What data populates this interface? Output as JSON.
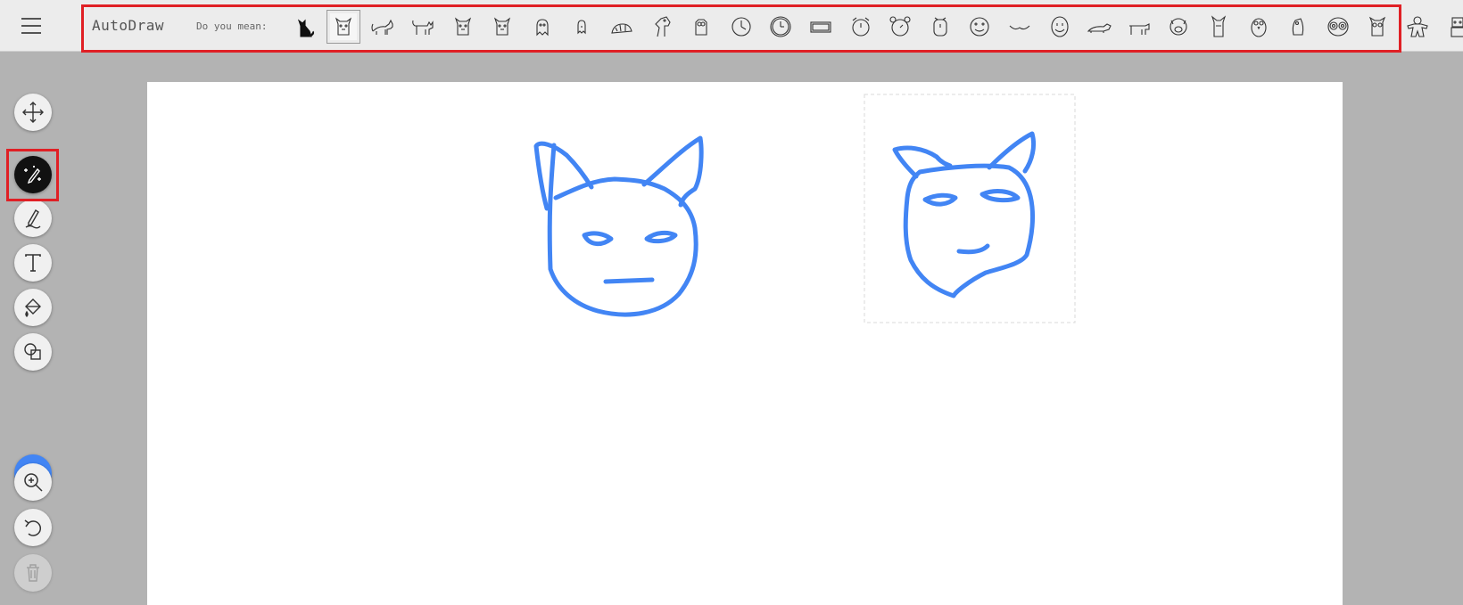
{
  "app": {
    "title": "AutoDraw"
  },
  "suggestions_bar": {
    "prompt_label": "Do you mean:",
    "items": [
      "black-cat-icon",
      "cat-face-icon",
      "cat-walking-icon",
      "cat-standing-icon",
      "cat-head-icon",
      "cat-sitting-icon",
      "ghost-icon",
      "ghost-small-icon",
      "armadillo-icon",
      "horse-head-icon",
      "owl-small-icon",
      "clock-icon",
      "clock-round-icon",
      "digital-clock-icon",
      "alarm-clock-icon",
      "alarm-clock-round-icon",
      "alarm-clock-tall-icon",
      "smiley-icon",
      "mustache-icon",
      "smiley-oval-icon",
      "dog-lying-icon",
      "cow-icon",
      "pig-face-icon",
      "cat-front-icon",
      "owl-icon",
      "owl-perched-icon",
      "owl-face-icon",
      "owl-standing-icon",
      "gingerbread-icon",
      "robot-icon"
    ],
    "selected_index": 1
  },
  "toolbar": {
    "tools": [
      {
        "name": "move-tool",
        "icon": "move-arrows-icon"
      },
      {
        "name": "autodraw-tool",
        "icon": "magic-pencil-icon",
        "active": true
      },
      {
        "name": "draw-tool",
        "icon": "pencil-icon"
      },
      {
        "name": "type-tool",
        "icon": "text-t-icon"
      },
      {
        "name": "fill-tool",
        "icon": "paint-bucket-icon"
      },
      {
        "name": "shape-tool",
        "icon": "shapes-icon"
      },
      {
        "name": "zoom-tool",
        "icon": "zoom-in-icon"
      },
      {
        "name": "undo-tool",
        "icon": "undo-icon"
      },
      {
        "name": "delete-tool",
        "icon": "trash-icon",
        "disabled": true
      }
    ],
    "color": "#4285f4"
  },
  "colors": {
    "stroke": "#4285f4",
    "highlight": "#e02025"
  }
}
